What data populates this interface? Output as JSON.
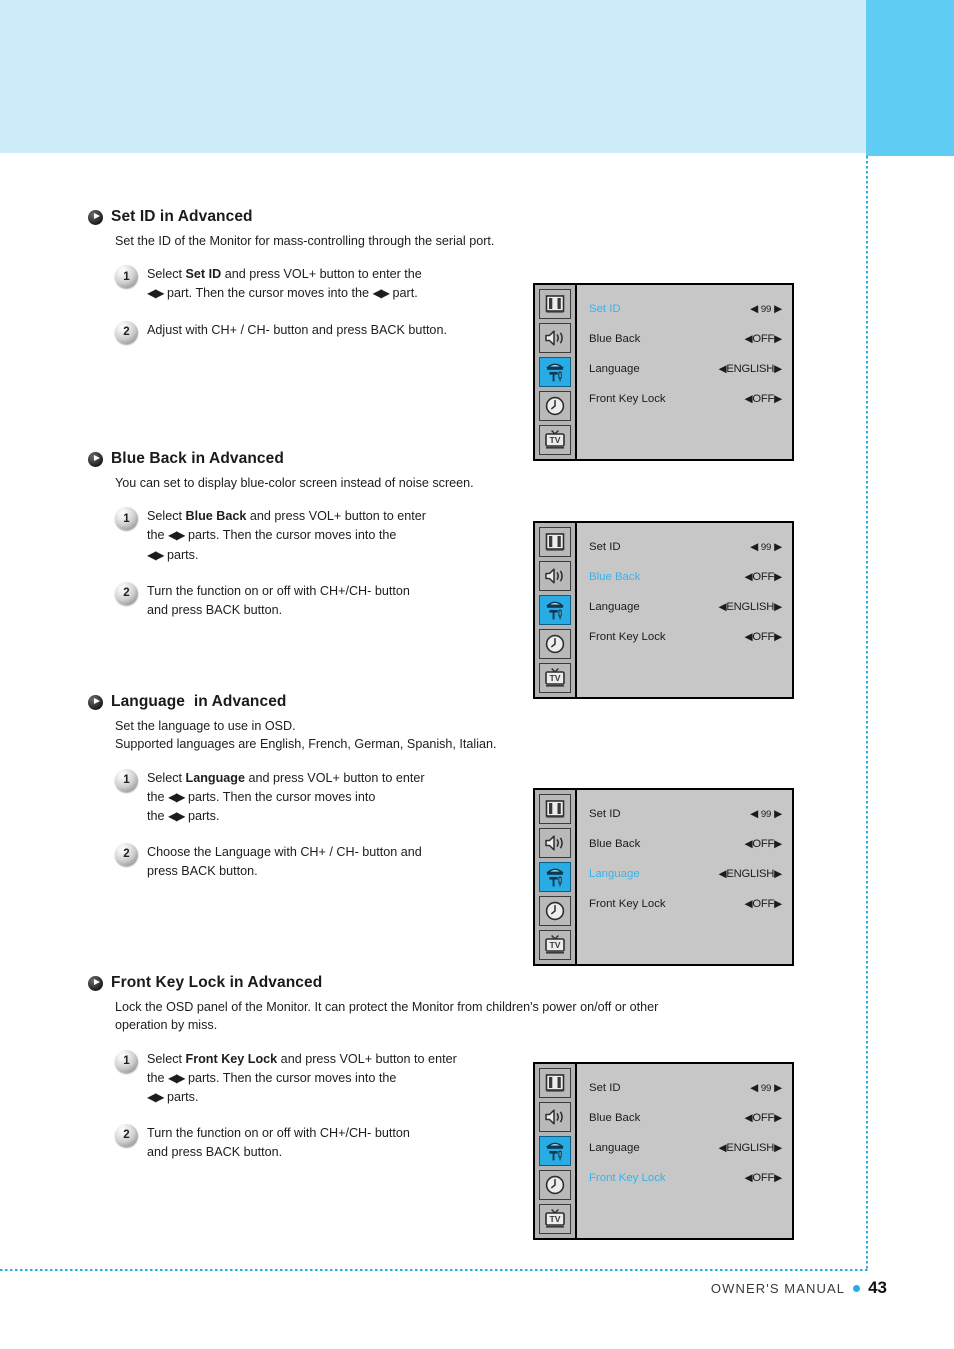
{
  "page": {
    "header_accent_color": "#5fcdf3",
    "header_band_color": "#cdedfa",
    "rule_color": "#29ace3"
  },
  "sections": [
    {
      "title": "Set ID in Advanced",
      "description": "Set the ID of the Monitor for mass-controlling through the serial port.",
      "steps": [
        {
          "num": "1",
          "parts": [
            {
              "t": "Select ",
              "b": false
            },
            {
              "t": "Set ID",
              "b": true
            },
            {
              "t": " and press VOL+ button to enter the",
              "b": false
            },
            {
              "t": "\n",
              "b": false
            },
            {
              "t": "◀▶",
              "b": false,
              "arrow": true
            },
            {
              "t": " part. Then the cursor moves into the ",
              "b": false
            },
            {
              "t": "◀▶",
              "b": false,
              "arrow": true
            },
            {
              "t": " part.",
              "b": false
            }
          ]
        },
        {
          "num": "2",
          "parts": [
            {
              "t": "Adjust with CH+ / CH- button and press BACK button.",
              "b": false
            }
          ]
        }
      ]
    },
    {
      "title": "Blue Back in Advanced",
      "description": "You can set to display blue-color screen instead of noise screen.",
      "steps": [
        {
          "num": "1",
          "parts": [
            {
              "t": "Select ",
              "b": false
            },
            {
              "t": "Blue Back",
              "b": true
            },
            {
              "t": " and press VOL+ button to enter",
              "b": false
            },
            {
              "t": "\n",
              "b": false
            },
            {
              "t": "the ",
              "b": false
            },
            {
              "t": "◀▶",
              "b": false,
              "arrow": true
            },
            {
              "t": " parts. Then the cursor moves into the",
              "b": false
            },
            {
              "t": "\n",
              "b": false
            },
            {
              "t": "◀▶",
              "b": false,
              "arrow": true
            },
            {
              "t": " parts.",
              "b": false
            }
          ]
        },
        {
          "num": "2",
          "parts": [
            {
              "t": "Turn the function on or off with CH+/CH- button",
              "b": false
            },
            {
              "t": "\n",
              "b": false
            },
            {
              "t": "and press BACK button.",
              "b": false
            }
          ]
        }
      ]
    },
    {
      "title": "Language  in Advanced",
      "description": "Set the language to use in OSD.\nSupported languages are English, French, German, Spanish, Italian.",
      "steps": [
        {
          "num": "1",
          "parts": [
            {
              "t": "Select ",
              "b": false
            },
            {
              "t": "Language",
              "b": true
            },
            {
              "t": " and press VOL+ button to enter",
              "b": false
            },
            {
              "t": "\n",
              "b": false
            },
            {
              "t": "the ",
              "b": false
            },
            {
              "t": "◀▶",
              "b": false,
              "arrow": true
            },
            {
              "t": " parts. Then the cursor moves into",
              "b": false
            },
            {
              "t": "\n",
              "b": false
            },
            {
              "t": "the ",
              "b": false
            },
            {
              "t": "◀▶",
              "b": false,
              "arrow": true
            },
            {
              "t": " parts.",
              "b": false
            }
          ]
        },
        {
          "num": "2",
          "parts": [
            {
              "t": "Choose the Language with CH+ / CH- button and",
              "b": false
            },
            {
              "t": "\n",
              "b": false
            },
            {
              "t": "press BACK button.",
              "b": false
            }
          ]
        }
      ]
    },
    {
      "title": "Front Key Lock in Advanced",
      "description": "Lock the OSD panel of the Monitor. It can protect the Monitor from children's power on/off or other\noperation by miss.",
      "steps": [
        {
          "num": "1",
          "parts": [
            {
              "t": "Select ",
              "b": false
            },
            {
              "t": "Front Key Lock",
              "b": true
            },
            {
              "t": " and press VOL+ button to enter",
              "b": false
            },
            {
              "t": "\n",
              "b": false
            },
            {
              "t": " the ",
              "b": false
            },
            {
              "t": "◀▶",
              "b": false,
              "arrow": true
            },
            {
              "t": " parts. Then the cursor moves into the",
              "b": false
            },
            {
              "t": "\n",
              "b": false
            },
            {
              "t": "◀▶",
              "b": false,
              "arrow": true
            },
            {
              "t": " parts.",
              "b": false
            }
          ]
        },
        {
          "num": "2",
          "parts": [
            {
              "t": "Turn the function on or off with CH+/CH- button",
              "b": false
            },
            {
              "t": "\n",
              "b": false
            },
            {
              "t": "and press BACK button.",
              "b": false
            }
          ]
        }
      ]
    }
  ],
  "osd": {
    "tabs": [
      {
        "icon": "picture-icon",
        "active": false
      },
      {
        "icon": "sound-icon",
        "active": false
      },
      {
        "icon": "setup-tools-icon",
        "active": true
      },
      {
        "icon": "clock-icon",
        "active": false
      },
      {
        "icon": "tv-icon",
        "active": false
      }
    ],
    "highlight_color": "#34b4ef",
    "rows": [
      {
        "label": "Set ID",
        "value": "99",
        "value_kind": "number"
      },
      {
        "label": "Blue Back",
        "value": "OFF",
        "value_kind": "text"
      },
      {
        "label": "Language",
        "value": "ENGLISH",
        "value_kind": "text"
      },
      {
        "label": "Front Key Lock",
        "value": "OFF",
        "value_kind": "text"
      }
    ],
    "panels": [
      {
        "selected_row": 0
      },
      {
        "selected_row": 1
      },
      {
        "selected_row": 2
      },
      {
        "selected_row": 3
      }
    ]
  },
  "footer": {
    "label": "OWNER'S MANUAL",
    "page": "43"
  }
}
